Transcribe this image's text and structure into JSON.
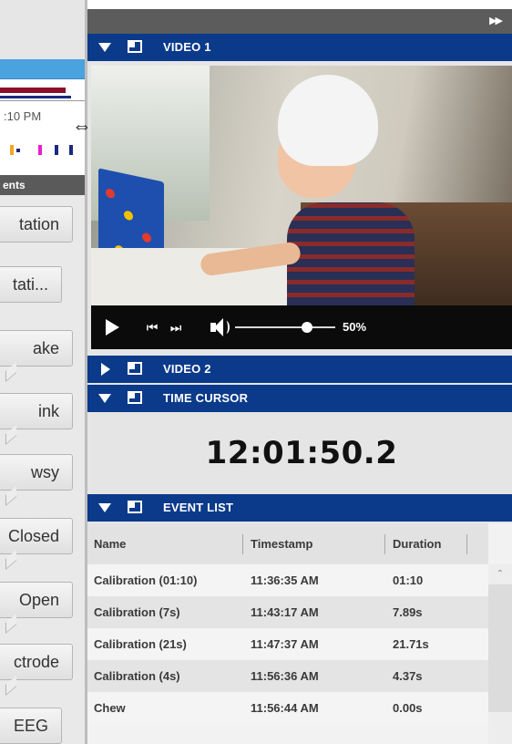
{
  "left_panel": {
    "timeline_time": ":10 PM",
    "events_header": "ents",
    "event_buttons": [
      "tation",
      "tati...",
      "ake",
      "ink",
      "wsy",
      "Closed",
      "Open",
      "ctrode",
      "EEG"
    ]
  },
  "right_panel": {
    "collapse_all_glyph": "▶▶",
    "video1": {
      "title": "VIDEO 1"
    },
    "player": {
      "prev_glyph": "⏮",
      "next_glyph": "⏭",
      "volume_percent": "50%",
      "volume_level": 0.5
    },
    "video2": {
      "title": "VIDEO 2"
    },
    "time_cursor": {
      "title": "TIME CURSOR",
      "value": "12:01:50.2"
    },
    "event_list": {
      "title": "EVENT LIST",
      "columns": [
        "Name",
        "Timestamp",
        "Duration"
      ],
      "rows": [
        {
          "name": "Calibration (01:10)",
          "timestamp": "11:36:35 AM",
          "duration": "01:10"
        },
        {
          "name": "Calibration (7s)",
          "timestamp": "11:43:17 AM",
          "duration": "7.89s"
        },
        {
          "name": "Calibration (21s)",
          "timestamp": "11:47:37 AM",
          "duration": "21.71s"
        },
        {
          "name": "Calibration (4s)",
          "timestamp": "11:56:36 AM",
          "duration": "4.37s"
        },
        {
          "name": "Chew",
          "timestamp": "11:56:44 AM",
          "duration": "0.00s"
        }
      ]
    }
  },
  "colors": {
    "header_blue": "#0b3a8b",
    "player_bar": "#0b0b0b",
    "timeline_red": "#8b0e2a",
    "timeline_navy": "#1a2a80"
  }
}
